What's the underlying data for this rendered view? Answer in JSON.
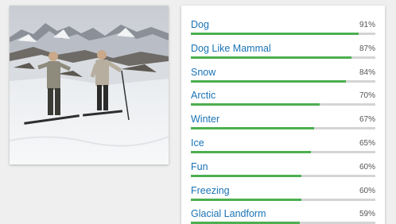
{
  "image": {
    "subject": "two-skiers-on-snowy-mountain"
  },
  "labels": [
    {
      "name": "Dog",
      "score_text": "91%",
      "score": 0.91
    },
    {
      "name": "Dog Like Mammal",
      "score_text": "87%",
      "score": 0.87
    },
    {
      "name": "Snow",
      "score_text": "84%",
      "score": 0.84
    },
    {
      "name": "Arctic",
      "score_text": "70%",
      "score": 0.7
    },
    {
      "name": "Winter",
      "score_text": "67%",
      "score": 0.67
    },
    {
      "name": "Ice",
      "score_text": "65%",
      "score": 0.65
    },
    {
      "name": "Fun",
      "score_text": "60%",
      "score": 0.6
    },
    {
      "name": "Freezing",
      "score_text": "60%",
      "score": 0.6
    },
    {
      "name": "Glacial Landform",
      "score_text": "59%",
      "score": 0.59
    }
  ],
  "colors": {
    "label_text": "#1a73b5",
    "bar_fill": "#4caf50",
    "bar_track": "#d4d4d4"
  }
}
